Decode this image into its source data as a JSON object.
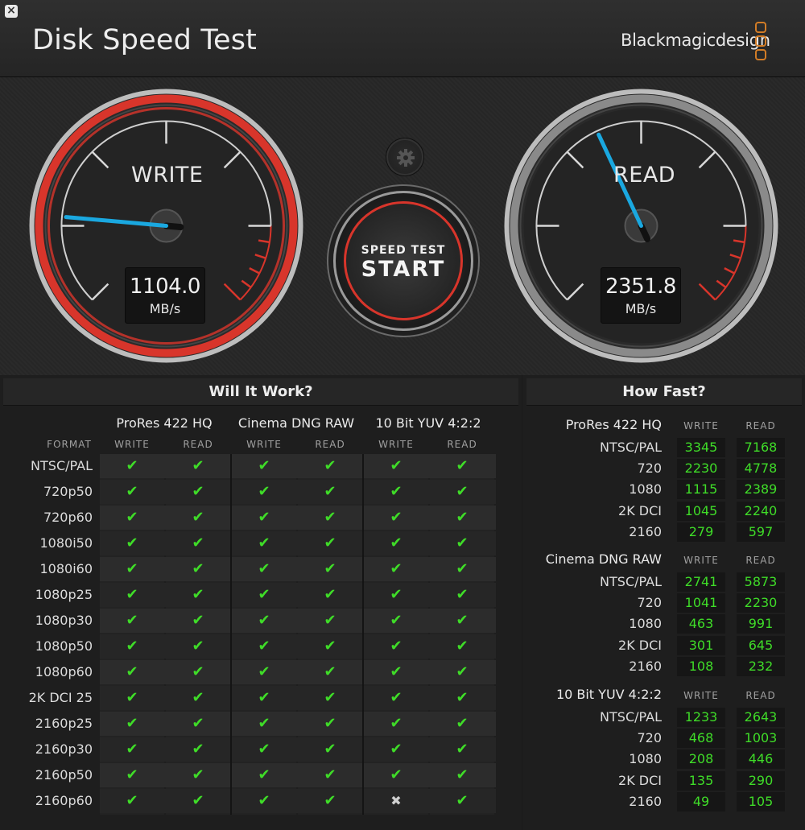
{
  "window": {
    "title": "Disk Speed Test",
    "brand": "Blackmagicdesign",
    "close_glyph": "×"
  },
  "gauges": {
    "write": {
      "label": "WRITE",
      "value": "1104.0",
      "unit": "MB/s",
      "color": "#d8352b"
    },
    "read": {
      "label": "READ",
      "value": "2351.8",
      "unit": "MB/s",
      "color": "#9a9a9a"
    },
    "needle_color": "#1aa8e0"
  },
  "controls": {
    "start_small": "SPEED TEST",
    "start_big": "START",
    "settings_icon": "gear-icon"
  },
  "will_it_work": {
    "title": "Will It Work?",
    "format_header": "FORMAT",
    "groups": [
      "ProRes 422 HQ",
      "Cinema DNG RAW",
      "10 Bit YUV 4:2:2"
    ],
    "subheaders": [
      "WRITE",
      "READ"
    ],
    "ok_glyph": "✔",
    "no_glyph": "✖",
    "rows": [
      {
        "format": "NTSC/PAL",
        "cells": [
          1,
          1,
          1,
          1,
          1,
          1
        ]
      },
      {
        "format": "720p50",
        "cells": [
          1,
          1,
          1,
          1,
          1,
          1
        ]
      },
      {
        "format": "720p60",
        "cells": [
          1,
          1,
          1,
          1,
          1,
          1
        ]
      },
      {
        "format": "1080i50",
        "cells": [
          1,
          1,
          1,
          1,
          1,
          1
        ]
      },
      {
        "format": "1080i60",
        "cells": [
          1,
          1,
          1,
          1,
          1,
          1
        ]
      },
      {
        "format": "1080p25",
        "cells": [
          1,
          1,
          1,
          1,
          1,
          1
        ]
      },
      {
        "format": "1080p30",
        "cells": [
          1,
          1,
          1,
          1,
          1,
          1
        ]
      },
      {
        "format": "1080p50",
        "cells": [
          1,
          1,
          1,
          1,
          1,
          1
        ]
      },
      {
        "format": "1080p60",
        "cells": [
          1,
          1,
          1,
          1,
          1,
          1
        ]
      },
      {
        "format": "2K DCI 25",
        "cells": [
          1,
          1,
          1,
          1,
          1,
          1
        ]
      },
      {
        "format": "2160p25",
        "cells": [
          1,
          1,
          1,
          1,
          1,
          1
        ]
      },
      {
        "format": "2160p30",
        "cells": [
          1,
          1,
          1,
          1,
          1,
          1
        ]
      },
      {
        "format": "2160p50",
        "cells": [
          1,
          1,
          1,
          1,
          1,
          1
        ]
      },
      {
        "format": "2160p60",
        "cells": [
          1,
          1,
          1,
          1,
          0,
          1
        ]
      }
    ]
  },
  "how_fast": {
    "title": "How Fast?",
    "sections": [
      {
        "name": "ProRes 422 HQ",
        "rows": [
          {
            "format": "NTSC/PAL",
            "write": "3345",
            "read": "7168"
          },
          {
            "format": "720",
            "write": "2230",
            "read": "4778"
          },
          {
            "format": "1080",
            "write": "1115",
            "read": "2389"
          },
          {
            "format": "2K DCI",
            "write": "1045",
            "read": "2240"
          },
          {
            "format": "2160",
            "write": "279",
            "read": "597"
          }
        ]
      },
      {
        "name": "Cinema DNG RAW",
        "rows": [
          {
            "format": "NTSC/PAL",
            "write": "2741",
            "read": "5873"
          },
          {
            "format": "720",
            "write": "1041",
            "read": "2230"
          },
          {
            "format": "1080",
            "write": "463",
            "read": "991"
          },
          {
            "format": "2K DCI",
            "write": "301",
            "read": "645"
          },
          {
            "format": "2160",
            "write": "108",
            "read": "232"
          }
        ]
      },
      {
        "name": "10 Bit YUV 4:2:2",
        "rows": [
          {
            "format": "NTSC/PAL",
            "write": "1233",
            "read": "2643"
          },
          {
            "format": "720",
            "write": "468",
            "read": "1003"
          },
          {
            "format": "1080",
            "write": "208",
            "read": "446"
          },
          {
            "format": "2K DCI",
            "write": "135",
            "read": "290"
          },
          {
            "format": "2160",
            "write": "49",
            "read": "105"
          }
        ]
      }
    ]
  }
}
